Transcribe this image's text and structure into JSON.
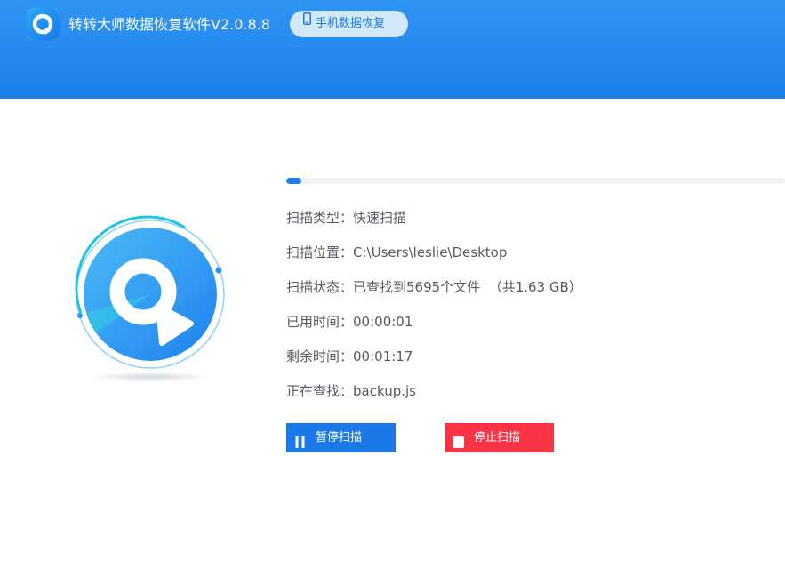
{
  "header": {
    "title": "转转大师数据恢复软件V2.0.8.8",
    "phone_recovery_label": "手机数据恢复",
    "logo_icon": "app-logo-icon"
  },
  "scan": {
    "progress_percent": 3,
    "rows": [
      {
        "label": "扫描类型：",
        "value": "快速扫描"
      },
      {
        "label": "扫描位置：",
        "value": "C:\\Users\\leslie\\Desktop"
      },
      {
        "label": "扫描状态：",
        "value": "已查找到5695个文件  （共1.63 GB）"
      },
      {
        "label": "已用时间：",
        "value": "00:00:01"
      },
      {
        "label": "剩余时间：",
        "value": "00:01:17"
      },
      {
        "label": "正在查找：",
        "value": "backup.js"
      }
    ],
    "pause_label": "暂停扫描",
    "stop_label": "停止扫描"
  },
  "colors": {
    "header_blue": "#1c80ea",
    "accent_blue": "#1c7ae8",
    "stop_red": "#fa3347",
    "progress_track": "#f1f2f4"
  }
}
